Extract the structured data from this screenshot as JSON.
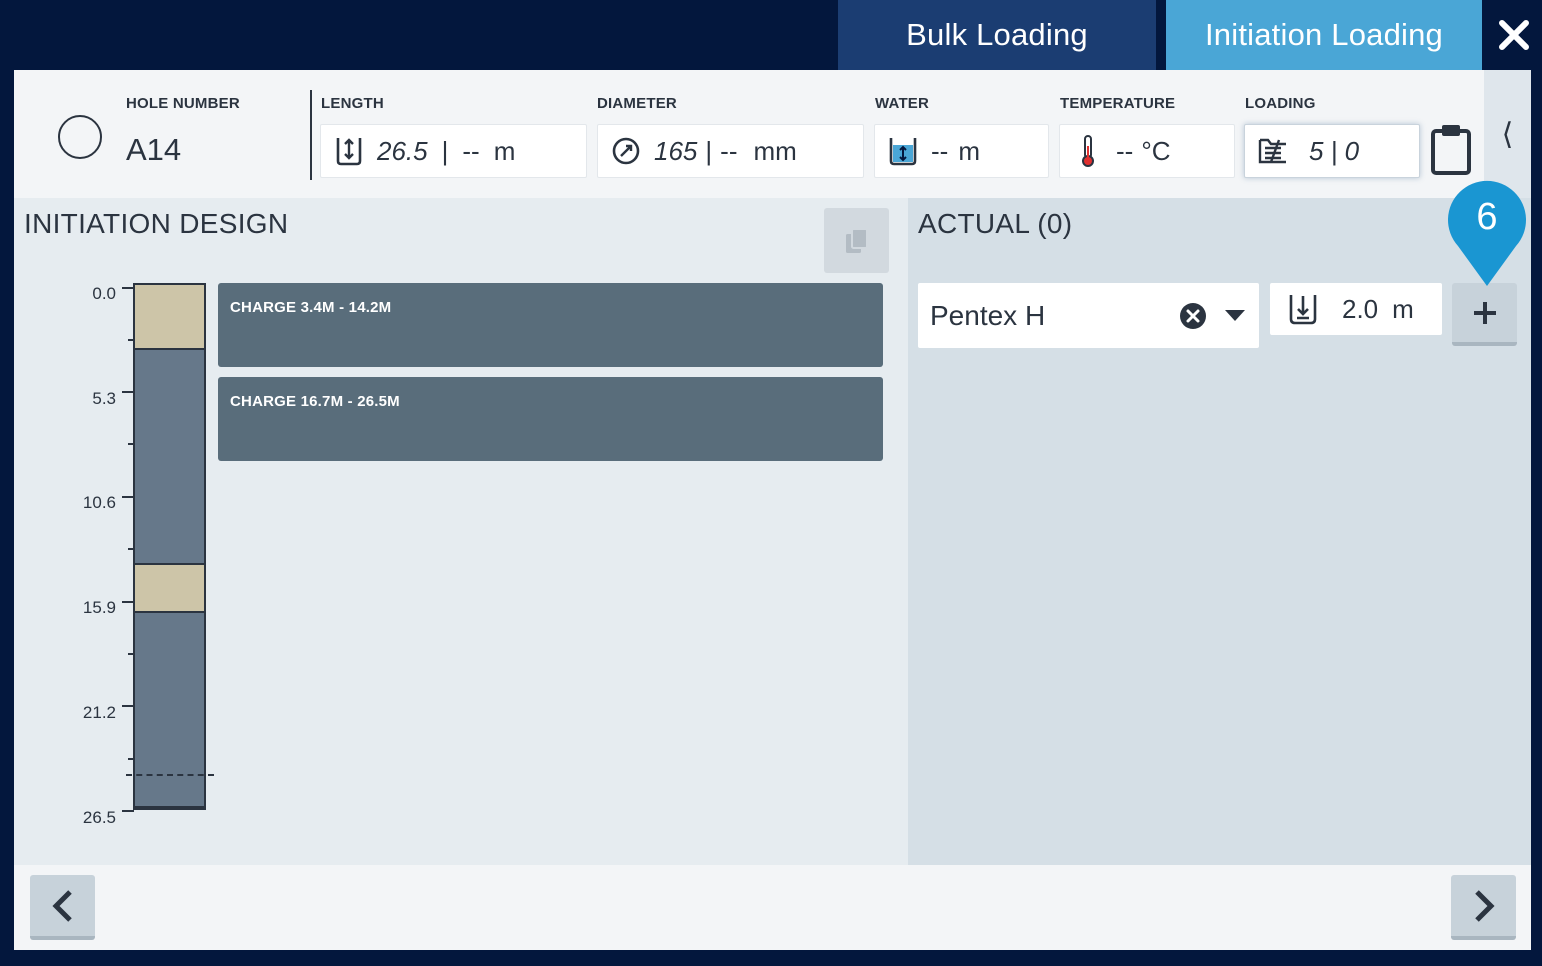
{
  "tabs": {
    "bulk_loading": "Bulk Loading",
    "initiation_loading": "Initiation Loading",
    "active": "initiation_loading"
  },
  "header": {
    "hole_number": {
      "label": "HOLE NUMBER",
      "value": "A14"
    },
    "length": {
      "label": "LENGTH",
      "design": "26.5",
      "actual": "--",
      "unit": "m"
    },
    "diameter": {
      "label": "DIAMETER",
      "design": "165",
      "actual": "--",
      "unit": "mm"
    },
    "water": {
      "label": "WATER",
      "value": "--",
      "unit": "m"
    },
    "temperature": {
      "label": "TEMPERATURE",
      "value": "--",
      "unit": "°C"
    },
    "loading": {
      "label": "LOADING",
      "value": "5 | 0"
    },
    "collapse_glyph": "⟨"
  },
  "initiation_design": {
    "title": "INITIATION DESIGN",
    "scale_labels": [
      "0.0",
      "5.3",
      "10.6",
      "15.9",
      "21.2",
      "26.5"
    ],
    "charges": [
      {
        "label": "CHARGE 3.4M - 14.2M"
      },
      {
        "label": "CHARGE 16.7M - 26.5M"
      }
    ]
  },
  "actual": {
    "title": "ACTUAL (0)",
    "product": "Pentex H",
    "length_value": "2.0",
    "length_unit": "m"
  },
  "callout": {
    "number": "6"
  },
  "colors": {
    "frame": "#03173d",
    "tab_bulk": "#1b3d72",
    "tab_active": "#4aa6d6",
    "charge_block": "#596d7b",
    "stemming": "#cdc5a8",
    "explosive_column": "#66788a",
    "callout": "#1a96d2"
  },
  "icons": {
    "close": "close-icon",
    "length": "hole-length-icon",
    "diameter": "diameter-icon",
    "water": "water-level-icon",
    "temperature": "thermometer-icon",
    "loading": "loading-icon",
    "clipboard": "clipboard-icon",
    "copy": "copy-icon",
    "clear": "clear-circle-icon",
    "dropdown": "caret-down-icon",
    "depth": "depth-icon",
    "add": "plus-icon",
    "prev": "chevron-left-icon",
    "next": "chevron-right-icon"
  }
}
